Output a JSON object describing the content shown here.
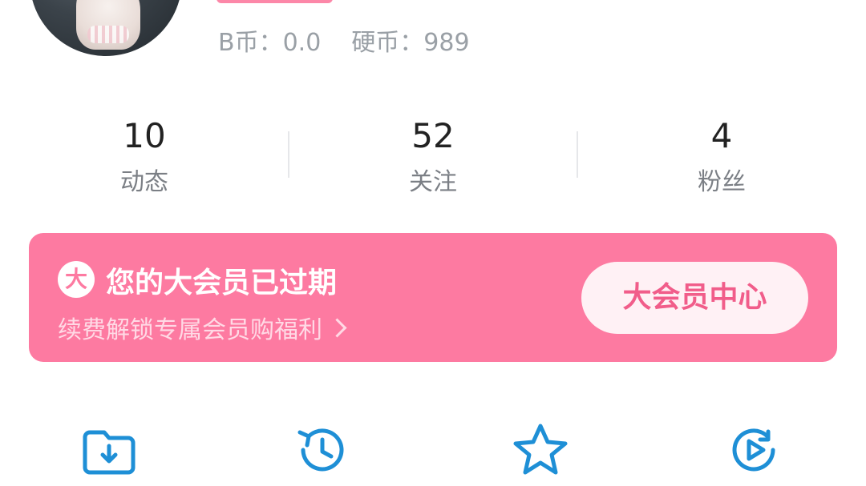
{
  "profile": {
    "coins": {
      "bcoin": "B币：0.0",
      "hardcoin": "硬币：989"
    }
  },
  "stats": [
    {
      "num": "10",
      "label": "动态"
    },
    {
      "num": "52",
      "label": "关注"
    },
    {
      "num": "4",
      "label": "粉丝"
    }
  ],
  "vip": {
    "badge": "大",
    "title": "您的大会员已过期",
    "subtitle": "续费解锁专属会员购福利",
    "button": "大会员中心"
  },
  "icons": {
    "download": "download-folder-icon",
    "history": "history-clock-icon",
    "favorites": "star-icon",
    "later": "play-later-icon"
  },
  "colors": {
    "accent": "#fd7aa1",
    "icon_blue": "#1e8fd6"
  }
}
